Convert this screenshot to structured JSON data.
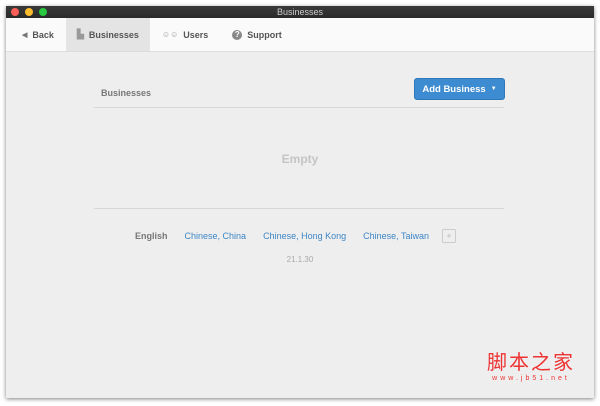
{
  "window": {
    "title": "Businesses"
  },
  "toolbar": {
    "back": "Back",
    "tabs": [
      {
        "label": "Businesses",
        "icon": "building-icon"
      },
      {
        "label": "Users",
        "icon": "users-icon"
      },
      {
        "label": "Support",
        "icon": "question-icon"
      }
    ]
  },
  "main": {
    "section_title": "Businesses",
    "add_button": "Add Business",
    "empty": "Empty",
    "languages": [
      "English",
      "Chinese, China",
      "Chinese, Hong Kong",
      "Chinese, Taiwan"
    ],
    "add_language": "+",
    "version": "21.1.30"
  },
  "watermark": {
    "title": "脚本之家",
    "url": "www.jb51.net"
  },
  "colors": {
    "accent": "#3d8bd0",
    "link": "#3d86c6"
  }
}
